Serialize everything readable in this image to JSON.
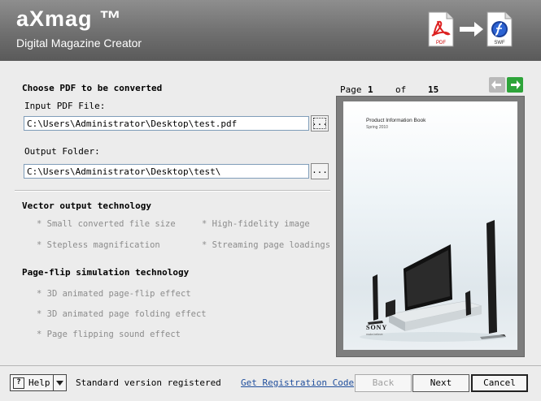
{
  "header": {
    "title": "aXmag ™",
    "subtitle": "Digital Magazine Creator",
    "pdf_label": "PDF",
    "swf_label": "SWF"
  },
  "convert": {
    "section_title": "Choose PDF to be converted",
    "input_label": "Input PDF File:",
    "input_value": "C:\\Users\\Administrator\\Desktop\\test.pdf",
    "output_label": "Output Folder:",
    "output_value": "C:\\Users\\Administrator\\Desktop\\test\\",
    "browse_label": "..."
  },
  "vector": {
    "section_title": "Vector output technology",
    "features": [
      "* Small converted file size",
      "* High-fidelity image",
      "* Stepless magnification",
      "* Streaming page loadings"
    ]
  },
  "pageflip": {
    "section_title": "Page-flip simulation technology",
    "features": [
      "* 3D animated page-flip effect",
      "* 3D animated page folding effect",
      "* Page flipping sound effect"
    ]
  },
  "pager": {
    "page_label": "Page",
    "current": "1",
    "of_label": "of",
    "total": "15"
  },
  "preview": {
    "book_title": "Product Information Book",
    "season": "Spring 2010",
    "brand": "SONY",
    "tagline": "make.believe"
  },
  "footer": {
    "help_label": "Help",
    "status": "Standard version registered",
    "registration_link": "Get Registration Code",
    "back_label": "Back",
    "next_label": "Next",
    "cancel_label": "Cancel"
  },
  "colors": {
    "header_bg": "#6f6f6f",
    "next_arrow": "#2ea43a",
    "link": "#1f4e9c"
  }
}
